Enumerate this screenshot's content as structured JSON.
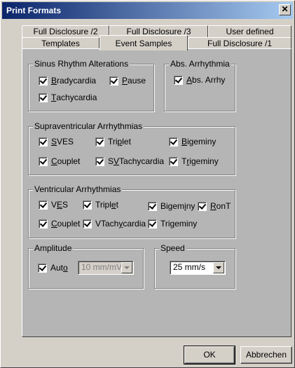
{
  "window": {
    "title": "Print Formats",
    "close_glyph": "✕"
  },
  "tabs_back": [
    "Full Disclosure /2",
    "Full Disclosure /3",
    "User defined"
  ],
  "tabs_front": [
    "Templates",
    "Event Samples",
    "Full Disclosure /1"
  ],
  "active_tab": "Event Samples",
  "sinus": {
    "title": "Sinus Rhythm Alterations",
    "items": [
      {
        "pre": "",
        "key": "B",
        "post": "radycardia",
        "checked": true
      },
      {
        "pre": "",
        "key": "P",
        "post": "ause",
        "checked": true
      },
      {
        "pre": "",
        "key": "T",
        "post": "achycardia",
        "checked": true
      }
    ]
  },
  "abs": {
    "title": "Abs. Arrhythmia",
    "items": [
      {
        "pre": "",
        "key": "A",
        "post": "bs. Arrhy",
        "checked": true
      }
    ]
  },
  "supra": {
    "title": "Supraventricular Arrhythmias",
    "items": [
      {
        "pre": "",
        "key": "S",
        "post": "VES",
        "checked": true
      },
      {
        "pre": "Tri",
        "key": "p",
        "post": "let",
        "checked": true
      },
      {
        "pre": "",
        "key": "B",
        "post": "igeminy",
        "checked": true
      },
      {
        "pre": "",
        "key": "C",
        "post": "ouplet",
        "checked": true
      },
      {
        "pre": "S",
        "key": "V",
        "post": "Tachycardia",
        "checked": true
      },
      {
        "pre": "T",
        "key": "r",
        "post": "igeminy",
        "checked": true
      }
    ]
  },
  "vent": {
    "title": "Ventricular Arrhythmias",
    "items": [
      {
        "pre": "V",
        "key": "E",
        "post": "S",
        "checked": true
      },
      {
        "pre": "Tripl",
        "key": "e",
        "post": "t",
        "checked": true
      },
      {
        "pre": "Bigem",
        "key": "i",
        "post": "ny",
        "checked": true
      },
      {
        "pre": "",
        "key": "R",
        "post": "onT",
        "checked": true
      },
      {
        "pre": "",
        "key": "C",
        "post": "ouplet",
        "checked": true
      },
      {
        "pre": "VTach",
        "key": "y",
        "post": "cardia",
        "checked": true
      },
      {
        "pre": "Tri",
        "key": "g",
        "post": "eminy",
        "checked": true
      }
    ]
  },
  "amplitude": {
    "title": "Amplitude",
    "auto": {
      "pre": "Aut",
      "key": "o",
      "post": "",
      "checked": true
    },
    "value": "10 mm/mV",
    "disabled": true
  },
  "speed": {
    "title": "Speed",
    "value": "25 mm/s"
  },
  "buttons": {
    "ok": "OK",
    "cancel": "Abbrechen"
  }
}
